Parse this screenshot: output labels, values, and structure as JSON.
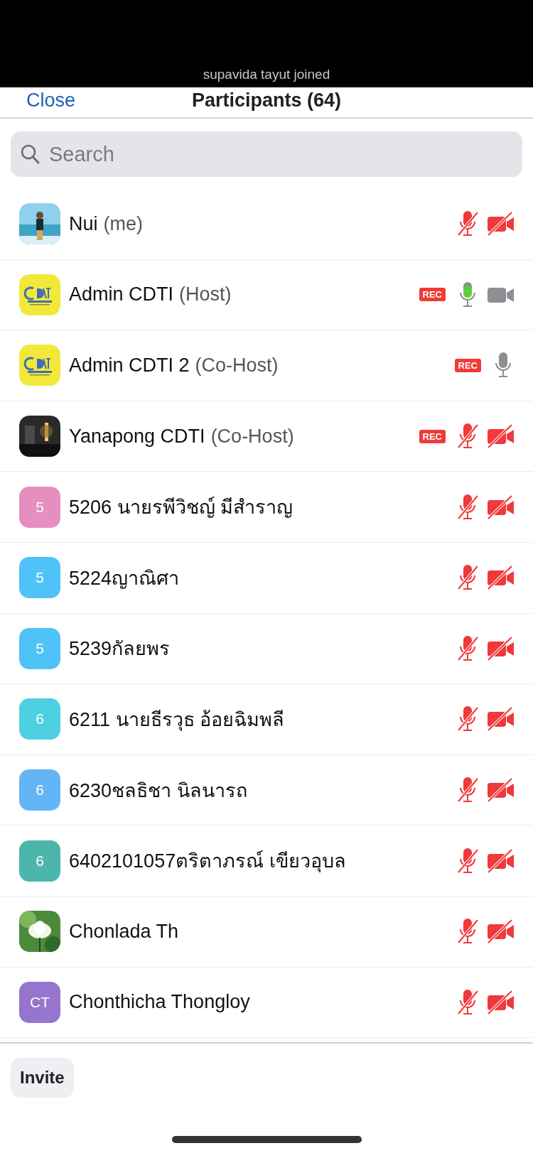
{
  "notification": {
    "text": "supavida tayut joined"
  },
  "header": {
    "close": "Close",
    "title": "Participants (64)"
  },
  "search": {
    "placeholder": "Search"
  },
  "participants": [
    {
      "name": "Nui",
      "role": "(me)",
      "mic_muted": true,
      "mic_active": false,
      "camera": true,
      "video_off": true
    },
    {
      "avatar": {
        "kind": "logo"
      },
      "name": "Admin CDTI",
      "role": "(Host)",
      "rec": "REC",
      "mic_muted": false,
      "mic_active": true,
      "camera": true,
      "video_off": false
    },
    {
      "avatar": {
        "kind": "logo"
      },
      "name": "Admin CDTI 2",
      "role": "(Co-Host)",
      "rec": "REC",
      "mic_muted": false,
      "mic_active": false,
      "camera": false
    },
    {
      "name": "Yanapong CDTI",
      "role": "(Co-Host)",
      "rec": "REC",
      "mic_muted": true,
      "mic_active": false,
      "camera": true,
      "video_off": true
    },
    {
      "avatar": {
        "kind": "initials",
        "text": "5",
        "color": "#e58fc0"
      },
      "name": "5206 นายรพีวิชญ์ มีสำราญ",
      "mic_muted": true,
      "mic_active": false,
      "camera": true,
      "video_off": true
    },
    {
      "avatar": {
        "kind": "initials",
        "text": "5",
        "color": "#4fc3f7"
      },
      "name": "5224ญาณิศา",
      "mic_muted": true,
      "mic_active": false,
      "camera": true,
      "video_off": true
    },
    {
      "avatar": {
        "kind": "initials",
        "text": "5",
        "color": "#4fc3f7"
      },
      "name": "5239กัลยพร",
      "mic_muted": true,
      "mic_active": false,
      "camera": true,
      "video_off": true
    },
    {
      "avatar": {
        "kind": "initials",
        "text": "6",
        "color": "#4dd0e1"
      },
      "name": "6211 นายธีรวุธ อ้อยฉิมพลี",
      "mic_muted": true,
      "mic_active": false,
      "camera": true,
      "video_off": true
    },
    {
      "avatar": {
        "kind": "initials",
        "text": "6",
        "color": "#64b5f6"
      },
      "name": "6230ชลธิชา นิลนารถ",
      "mic_muted": true,
      "mic_active": false,
      "camera": true,
      "video_off": true
    },
    {
      "avatar": {
        "kind": "initials",
        "text": "6",
        "color": "#4db6ac"
      },
      "name": "6402101057ตริตาภรณ์ เขียวอุบล",
      "mic_muted": true,
      "mic_active": false,
      "camera": true,
      "video_off": true
    },
    {
      "name": "Chonlada Th",
      "mic_muted": true,
      "mic_active": false,
      "camera": true,
      "video_off": true
    },
    {
      "avatar": {
        "kind": "initials",
        "text": "CT",
        "color": "#9575cd"
      },
      "name": "Chonthicha Thongloy",
      "mic_muted": true,
      "mic_active": false,
      "camera": true,
      "video_off": true
    }
  ],
  "footer": {
    "invite": "Invite"
  }
}
